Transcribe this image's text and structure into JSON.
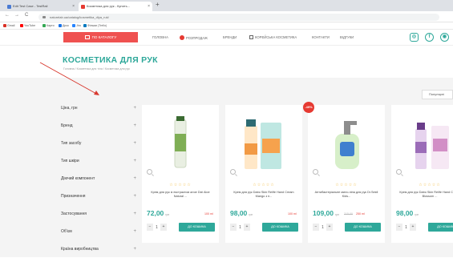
{
  "browser": {
    "tabs": [
      {
        "label": "Edit Test Case - TestRail"
      },
      {
        "label": "Косметика для рук - Купить..."
      }
    ],
    "new_tab": "+",
    "nav": {
      "back": "←",
      "forward": "→",
      "reload": "C"
    },
    "url": "naturelab.ua/catalog/kosmetika_dlya_ruk/",
    "bookmarks": [
      {
        "label": "Gmail",
        "color": "#d93025"
      },
      {
        "label": "YouTube",
        "color": "#ff0000"
      },
      {
        "label": "Карти",
        "color": "#34a853"
      },
      {
        "label": "Диск",
        "color": "#1a73e8"
      },
      {
        "label": "Jira",
        "color": "#2684ff"
      },
      {
        "label": "Фільми (Trello)",
        "color": "#0079bf"
      }
    ]
  },
  "header": {
    "catalog_button": "ПО КАТАЛОГУ",
    "nav": [
      "ГОЛОВНА",
      "РОЗПРОДАЖ",
      "БРЕНДИ",
      "КОРЕЙСЬКА КОСМЕТИКА",
      "КОНТАКТИ",
      "ВІДГУКИ"
    ],
    "social": [
      "◎",
      "f",
      "◉"
    ]
  },
  "page": {
    "title": "КОСМЕТИКА ДЛЯ РУК",
    "breadcrumb": "Головна / Косметика для тіла / Косметика для рук",
    "sort_label": "Популярні"
  },
  "sidebar": {
    "filters": [
      {
        "label": "Ціна, грн"
      },
      {
        "label": "Бренд"
      },
      {
        "label": "Тип засобу"
      },
      {
        "label": "Тип шкіри"
      },
      {
        "label": "Діючий компонент"
      },
      {
        "label": "Призначення"
      },
      {
        "label": "Застосування"
      },
      {
        "label": "Об'єм"
      },
      {
        "label": "Країна виробництва"
      }
    ]
  },
  "products": [
    {
      "name": "Крем для рук із екстрактом алое Dizi Aloe Natural ...",
      "stars": "☆☆☆☆☆",
      "price": "72,00",
      "currency": "грн",
      "old_price": "",
      "points": "100 ml",
      "qty": "1",
      "buy_label": "ДО КОШИКА",
      "badge": ""
    },
    {
      "name": "Крем для рук Dabo Skin Relife Hand Cream Mango з п...",
      "stars": "☆☆☆☆☆",
      "price": "98,00",
      "currency": "грн",
      "old_price": "",
      "points": "100 ml",
      "qty": "1",
      "buy_label": "ДО КОШИКА",
      "badge": ""
    },
    {
      "name": "Антибактеріальне мило-піна для рук Dr.Seidl Kids...",
      "stars": "☆☆☆☆☆",
      "price": "109,00",
      "currency": "грн",
      "old_price": "215,00",
      "points": "250 ml",
      "qty": "1",
      "buy_label": "ДО КОШИКА",
      "badge": "-49%"
    },
    {
      "name": "Крем для рук Dabo Skin Relife Hand Cream Blossom ...",
      "stars": "☆☆☆☆☆",
      "price": "98,00",
      "currency": "грн",
      "old_price": "",
      "points": "100 ml",
      "qty": "1",
      "buy_label": "ДО КОШИКА",
      "badge": ""
    }
  ],
  "colors": {
    "accent": "#2ea89a",
    "catalog_red": "#ef5150",
    "annotation_red": "#d8392f"
  }
}
